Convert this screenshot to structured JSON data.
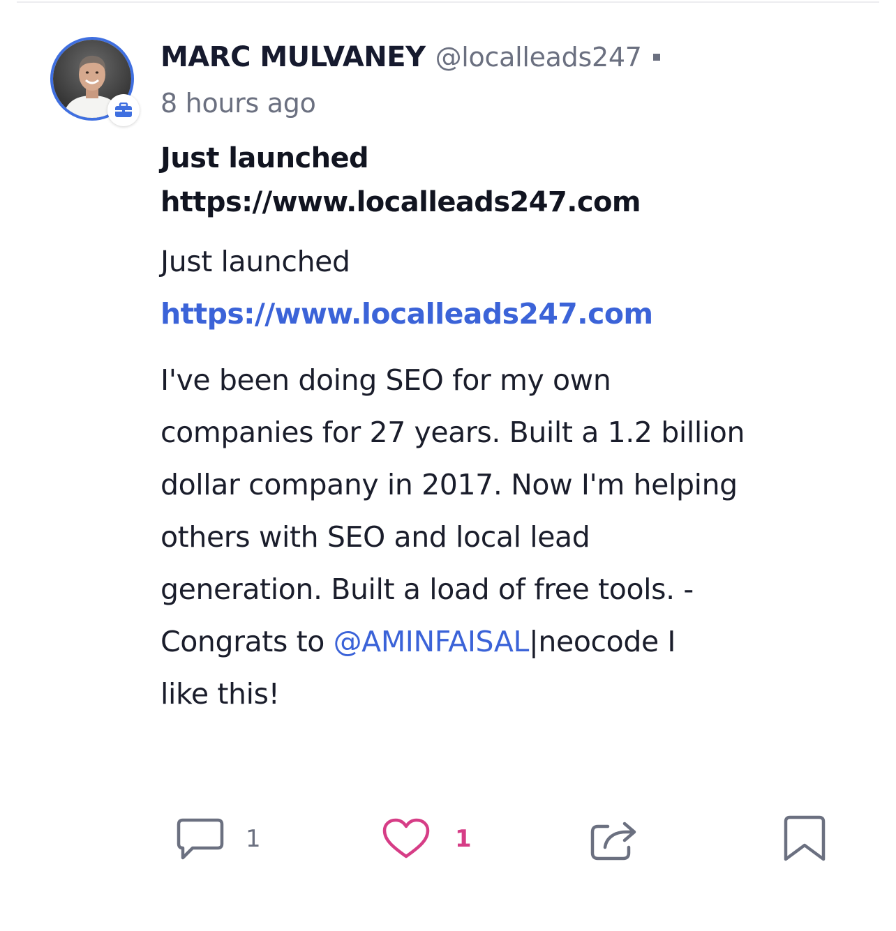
{
  "author": {
    "name": "MARC MULVANEY",
    "handle": "@localleads247",
    "avatar_icon": "profile-photo",
    "badge_icon": "briefcase-icon"
  },
  "timestamp": "8 hours ago",
  "title_lines": [
    "Just launched",
    "https://www.localleads247.com"
  ],
  "body": {
    "launch_line": "Just launched",
    "link": "https://www.localleads247.com",
    "lines": [
      "I've been doing SEO for my own",
      "companies for 27 years. Built a 1.2 billion",
      "dollar company in 2017. Now I'm helping",
      "others with SEO and local lead",
      "generation. Built a load of free tools. -"
    ],
    "mention_prefix": "Congrats to ",
    "mention": "@AMINFAISAL",
    "mention_suffix": "|neocode I",
    "last_line": "like this!"
  },
  "actions": {
    "comment_count": "1",
    "like_count": "1"
  },
  "colors": {
    "accent": "#3b63d8",
    "like": "#d63d86",
    "muted": "#6b7080",
    "avatar_ring": "#3f6fe0"
  }
}
